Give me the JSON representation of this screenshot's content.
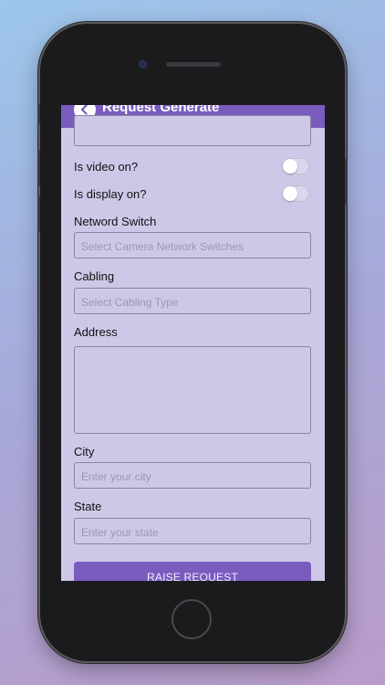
{
  "header": {
    "title": "Request Generate"
  },
  "form": {
    "video_label": "Is video on?",
    "video_on": false,
    "display_label": "Is display on?",
    "display_on": false,
    "network_switch_label": "Netword Switch",
    "network_switch_placeholder": "Select Camera Network Switches",
    "cabling_label": "Cabling",
    "cabling_placeholder": "Select Cabling Type",
    "address_label": "Address",
    "address_value": "",
    "city_label": "City",
    "city_placeholder": "Enter your city",
    "state_label": "State",
    "state_placeholder": "Enter your state",
    "submit_label": "RAISE REQUEST"
  },
  "colors": {
    "accent": "#7a5cbf",
    "screen_background": "#cfc7e8",
    "field_border": "#8a84a0",
    "placeholder_text": "#9d96b6"
  },
  "icons": {
    "back": "chevron-left-icon"
  }
}
